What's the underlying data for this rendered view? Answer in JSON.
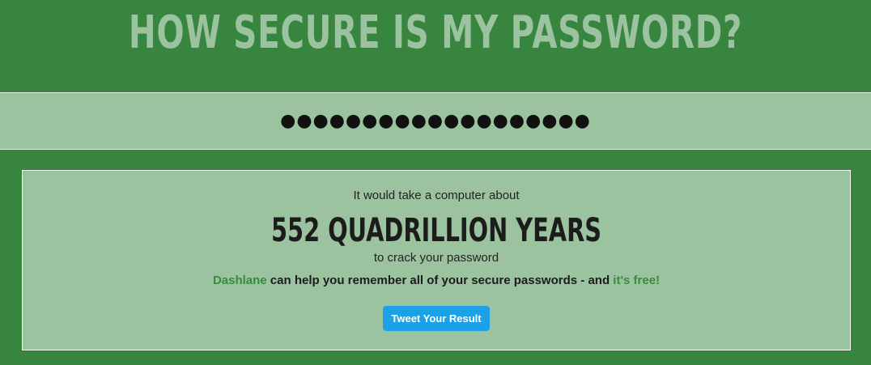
{
  "header": {
    "title": "HOW SECURE IS MY PASSWORD?"
  },
  "password": {
    "masked_value": "●●●●●●●●●●●●●●●●●●●"
  },
  "result": {
    "intro": "It would take a computer about",
    "time": "552 QUADRILLION YEARS",
    "outro": "to crack your password",
    "promo_brand": "Dashlane",
    "promo_text": " can help you remember all of your secure passwords - and ",
    "promo_link": "it's free!",
    "tweet_label": "Tweet Your Result"
  },
  "colors": {
    "background": "#388540",
    "panel": "#9cc3a0",
    "title": "#9cc3a0",
    "link": "#3a8a3f",
    "tweet_button": "#1da1e6"
  }
}
